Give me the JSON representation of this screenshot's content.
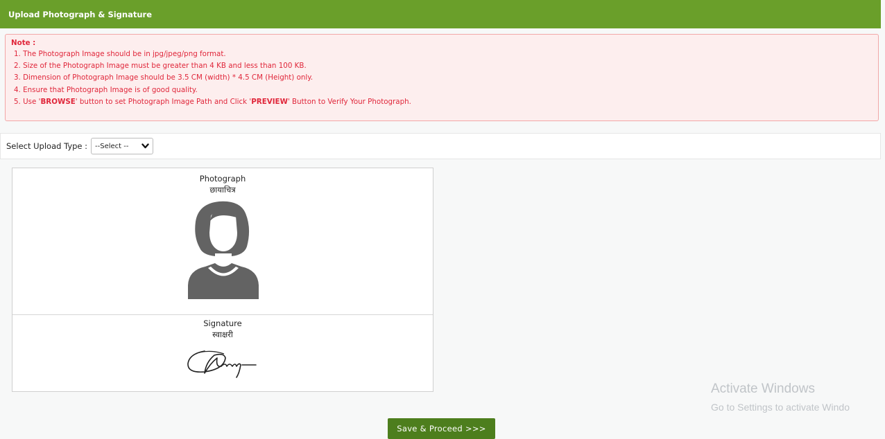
{
  "header": {
    "title": "Upload Photograph & Signature"
  },
  "note": {
    "title": "Note :",
    "items": [
      {
        "pre": "1. The Photograph Image should be in jpg/jpeg/png format.",
        "b1": "",
        "mid": "",
        "b2": "",
        "post": ""
      },
      {
        "pre": "2. Size of the Photograph Image must be greater than 4 KB and less than 100 KB.",
        "b1": "",
        "mid": "",
        "b2": "",
        "post": ""
      },
      {
        "pre": "3. Dimension of Photograph Image should be 3.5 CM (width) * 4.5 CM (Height) only.",
        "b1": "",
        "mid": "",
        "b2": "",
        "post": ""
      },
      {
        "pre": "4. Ensure that Photograph Image is of good quality.",
        "b1": "",
        "mid": "",
        "b2": "",
        "post": ""
      },
      {
        "pre": "5. Use '",
        "b1": "BROWSE",
        "mid": "' button to set Photograph Image Path and Click '",
        "b2": "PREVIEW",
        "post": "' Button to Verify Your Photograph."
      }
    ]
  },
  "upload": {
    "label": "Select Upload Type :",
    "selected": "--Select --"
  },
  "photo": {
    "caption_en": "Photograph",
    "caption_hi": "छायाचित्र"
  },
  "signature": {
    "caption_en": "Signature",
    "caption_hi": "स्वाक्षरी"
  },
  "watermark": {
    "line1": "Activate Windows",
    "line2": "Go to Settings to activate Windo"
  },
  "actions": {
    "save_label": "Save & Proceed >>>"
  },
  "colors": {
    "header": "#6a9f2a",
    "note_text": "#e0263a",
    "button": "#4d7e1d"
  }
}
